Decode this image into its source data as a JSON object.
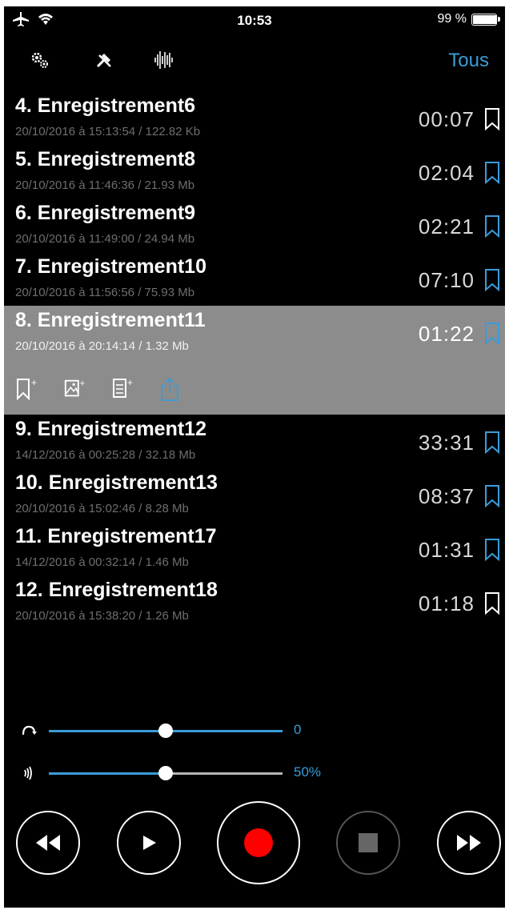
{
  "status_bar": {
    "time": "10:53",
    "battery_text": "99 %",
    "battery_level": 0.99,
    "icons": [
      "airplane-icon",
      "wifi-icon"
    ]
  },
  "toolbar": {
    "icons": [
      "settings-gears-icon",
      "tools-icon",
      "waveform-icon"
    ],
    "filter_label": "Tous",
    "accent_color": "#3a9bd9"
  },
  "recordings": [
    {
      "title": "4. Enregistrement6",
      "meta": "20/10/2016 à 15:13:54 / 122.82 Kb",
      "duration": "00:07",
      "bookmark_color": "#ffffff"
    },
    {
      "title": "5. Enregistrement8",
      "meta": "20/10/2016 à 11:46:36 / 21.93 Mb",
      "duration": "02:04",
      "bookmark_color": "#3a9bd9"
    },
    {
      "title": "6. Enregistrement9",
      "meta": "20/10/2016 à 11:49:00 / 24.94 Mb",
      "duration": "02:21",
      "bookmark_color": "#3a9bd9"
    },
    {
      "title": "7. Enregistrement10",
      "meta": "20/10/2016 à 11:56:56 / 75.93 Mb",
      "duration": "07:10",
      "bookmark_color": "#3a9bd9"
    },
    {
      "title": "8. Enregistrement11",
      "meta": "20/10/2016 à 20:14:14 / 1.32 Mb",
      "duration": "01:22",
      "bookmark_color": "#3a9bd9",
      "selected": true,
      "actions": [
        "add-bookmark-icon",
        "add-image-icon",
        "add-note-icon",
        "share-icon"
      ]
    },
    {
      "title": "9. Enregistrement12",
      "meta": "14/12/2016 à 00:25:28 / 32.18 Mb",
      "duration": "33:31",
      "bookmark_color": "#3a9bd9"
    },
    {
      "title": "10. Enregistrement13",
      "meta": "20/10/2016 à 15:02:46 / 8.28 Mb",
      "duration": "08:37",
      "bookmark_color": "#3a9bd9"
    },
    {
      "title": "11. Enregistrement17",
      "meta": "14/12/2016 à 00:32:14 / 1.46 Mb",
      "duration": "01:31",
      "bookmark_color": "#3a9bd9"
    },
    {
      "title": "12. Enregistrement18",
      "meta": "20/10/2016 à 15:38:20 / 1.26 Mb",
      "duration": "01:18",
      "bookmark_color": "#ffffff"
    }
  ],
  "sliders": [
    {
      "icon": "undo-arrow-icon",
      "value_text": "0",
      "level": 0.5,
      "rest_color": "#3a9bd9"
    },
    {
      "icon": "sound-waves-icon",
      "value_text": "50%",
      "level": 0.5,
      "rest_color": "#b4b4b4"
    }
  ],
  "transport": {
    "buttons": [
      "rewind-button",
      "play-button",
      "record-button",
      "stop-button",
      "fast-forward-button"
    ],
    "record_color": "#ff0000"
  }
}
